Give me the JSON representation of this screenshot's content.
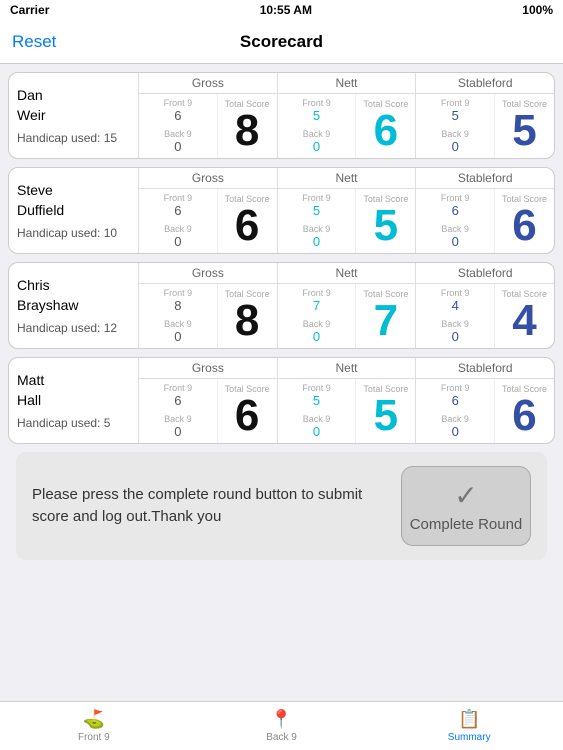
{
  "statusBar": {
    "carrier": "Carrier",
    "wifi": "wifi",
    "time": "10:55 AM",
    "battery": "100%"
  },
  "navBar": {
    "title": "Scorecard",
    "resetLabel": "Reset"
  },
  "players": [
    {
      "name": "Dan\nWeir",
      "handicap": "Handicap used: 15",
      "gross": {
        "front": "6",
        "back": "0",
        "total": "8"
      },
      "nett": {
        "front": "5",
        "back": "0",
        "total": "6"
      },
      "stableford": {
        "front": "5",
        "back": "0",
        "total": "5"
      }
    },
    {
      "name": "Steve\nDuffield",
      "handicap": "Handicap used: 10",
      "gross": {
        "front": "6",
        "back": "0",
        "total": "6"
      },
      "nett": {
        "front": "5",
        "back": "0",
        "total": "5"
      },
      "stableford": {
        "front": "6",
        "back": "0",
        "total": "6"
      }
    },
    {
      "name": "Chris\nBrayshaw",
      "handicap": "Handicap used: 12",
      "gross": {
        "front": "8",
        "back": "0",
        "total": "8"
      },
      "nett": {
        "front": "7",
        "back": "0",
        "total": "7"
      },
      "stableford": {
        "front": "4",
        "back": "0",
        "total": "4"
      }
    },
    {
      "name": "Matt\nHall",
      "handicap": "Handicap used: 5",
      "gross": {
        "front": "6",
        "back": "0",
        "total": "6"
      },
      "nett": {
        "front": "5",
        "back": "0",
        "total": "5"
      },
      "stableford": {
        "front": "6",
        "back": "0",
        "total": "6"
      }
    }
  ],
  "sectionHeaders": {
    "gross": "Gross",
    "nett": "Nett",
    "stableford": "Stableford"
  },
  "subLabels": {
    "front9": "Front 9",
    "back9": "Back 9",
    "totalScore": "Total Score"
  },
  "completeSection": {
    "text": "Please press the complete round button to submit score and log out.Thank you",
    "buttonLabel": "Complete Round"
  },
  "tabBar": {
    "tabs": [
      {
        "id": "front9",
        "label": "Front 9",
        "icon": "flag"
      },
      {
        "id": "back9",
        "label": "Back 9",
        "icon": "pin"
      },
      {
        "id": "summary",
        "label": "Summary",
        "icon": "doc",
        "active": true
      }
    ]
  }
}
